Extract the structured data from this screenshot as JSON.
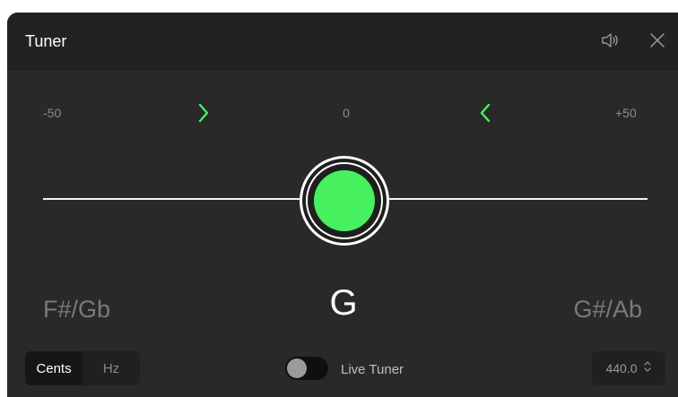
{
  "window": {
    "title": "Tuner"
  },
  "icons": {
    "speaker": "speaker-icon",
    "close": "close-icon",
    "chevrons": "chevron-icon"
  },
  "scale": {
    "left": "-50",
    "center": "0",
    "right": "+50"
  },
  "notes": {
    "flat": "F#/Gb",
    "current": "G",
    "sharp": "G#/Ab"
  },
  "mode": {
    "options": [
      "Cents",
      "Hz"
    ],
    "selected": "Cents"
  },
  "live_tuner": {
    "label": "Live Tuner",
    "enabled": false
  },
  "reference": {
    "value": "440.0"
  },
  "colors": {
    "accent": "#46f05f",
    "background": "#292929",
    "titlebar": "#222222"
  }
}
